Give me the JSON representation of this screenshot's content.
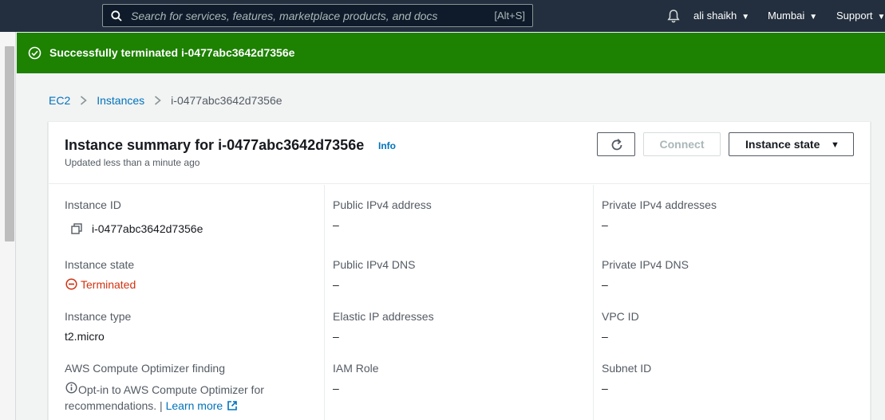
{
  "topnav": {
    "search_placeholder": "Search for services, features, marketplace products, and docs",
    "search_shortcut": "[Alt+S]",
    "user_label": "ali shaikh",
    "region_label": "Mumbai",
    "support_label": "Support"
  },
  "flash": {
    "message": "Successfully terminated i-0477abc3642d7356e",
    "color": "#1d8102"
  },
  "breadcrumb": {
    "items": [
      "EC2",
      "Instances"
    ],
    "current": "i-0477abc3642d7356e"
  },
  "summary": {
    "title": "Instance summary for i-0477abc3642d7356e",
    "info_label": "Info",
    "subtitle": "Updated less than a minute ago",
    "connect_label": "Connect",
    "instance_state_label": "Instance state"
  },
  "fields": {
    "instance_id": {
      "label": "Instance ID",
      "value": "i-0477abc3642d7356e"
    },
    "instance_state": {
      "label": "Instance state",
      "value": "Terminated",
      "status_color": "#d13212"
    },
    "instance_type": {
      "label": "Instance type",
      "value": "t2.micro"
    },
    "optimizer": {
      "label": "AWS Compute Optimizer finding",
      "text_line1": "Opt-in to AWS Compute Optimizer for",
      "text_line2": "recommendations. |",
      "link_label": "Learn more"
    },
    "public_ipv4": {
      "label": "Public IPv4 address",
      "value": "–"
    },
    "public_dns": {
      "label": "Public IPv4 DNS",
      "value": "–"
    },
    "elastic_ip": {
      "label": "Elastic IP addresses",
      "value": "–"
    },
    "iam_role": {
      "label": "IAM Role",
      "value": "–"
    },
    "private_ipv4": {
      "label": "Private IPv4 addresses",
      "value": "–"
    },
    "private_dns": {
      "label": "Private IPv4 DNS",
      "value": "–"
    },
    "vpc_id": {
      "label": "VPC ID",
      "value": "–"
    },
    "subnet_id": {
      "label": "Subnet ID",
      "value": "–"
    }
  },
  "colors": {
    "nav_bg": "#232f3e",
    "link": "#0073bb",
    "success": "#1d8102",
    "error": "#d13212"
  }
}
